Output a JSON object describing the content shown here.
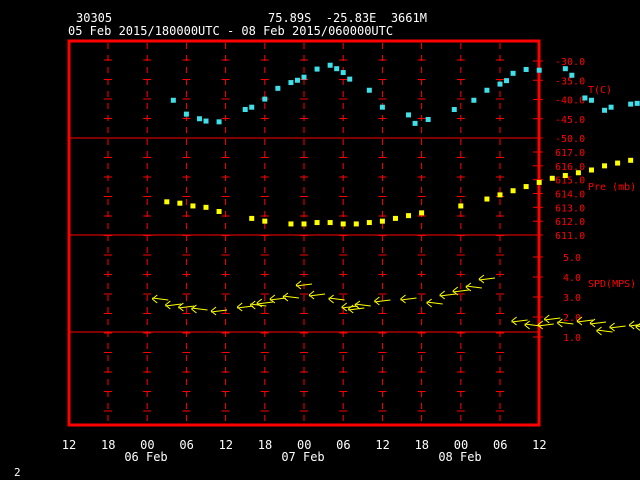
{
  "header": {
    "station_id": "30305",
    "location": "75.89S  -25.83E  3661M",
    "time_range": "05 Feb 2015/180000UTC - 08 Feb 2015/060000UTC"
  },
  "page_number": "2",
  "colors": {
    "frame": "#ff0000",
    "temperature": "#40e0e8",
    "pressure": "#ffff00",
    "wind": "#ffff00",
    "axis_text": "#ffffff",
    "right_labels": "#ff0000"
  },
  "chart_data": [
    {
      "type": "scatter",
      "title": "T(C)",
      "x_unit": "hours since 06 Feb 00UTC",
      "ylim": [
        -50,
        -30
      ],
      "yticks": [
        "-30.0",
        "-35.0",
        "-40.0",
        "-45.0",
        "-50.0"
      ],
      "x": [
        -8,
        -6,
        -4,
        -3,
        -1,
        3,
        4,
        6,
        8,
        10,
        11,
        12,
        14,
        16,
        17,
        18,
        19,
        22,
        24,
        28,
        29,
        31,
        35,
        38,
        40,
        42,
        43,
        44,
        46,
        48,
        52,
        53,
        55,
        56,
        58,
        59,
        62,
        63,
        64
      ],
      "values": [
        -40.2,
        -43.8,
        -45.0,
        -45.6,
        -45.8,
        -42.6,
        -42.0,
        -39.9,
        -37.1,
        -35.6,
        -35.0,
        -34.2,
        -32.1,
        -31.1,
        -32.0,
        -33.0,
        -34.7,
        -37.6,
        -42.0,
        -44.0,
        -46.2,
        -45.2,
        -42.6,
        -40.2,
        -37.6,
        -36.0,
        -35.1,
        -33.2,
        -32.2,
        -32.4,
        -32.0,
        -33.7,
        -39.6,
        -40.2,
        -42.8,
        -42.0,
        -41.2,
        -41.0,
        -38.4,
        -39.0
      ]
    },
    {
      "type": "scatter",
      "title": "Pre (mb)",
      "x_unit": "hours since 06 Feb 00UTC",
      "ylim": [
        611,
        617
      ],
      "yticks": [
        "617.0",
        "616.0",
        "615.0",
        "614.0",
        "613.0",
        "612.0",
        "611.0"
      ],
      "x": [
        -9,
        -7,
        -5,
        -3,
        -1,
        4,
        6,
        10,
        12,
        14,
        16,
        18,
        20,
        22,
        24,
        26,
        28,
        30,
        36,
        40,
        42,
        44,
        46,
        48,
        50,
        52,
        54,
        56,
        58,
        60,
        62,
        64,
        66,
        70,
        72
      ],
      "values": [
        613.4,
        613.3,
        613.1,
        613.0,
        612.7,
        612.2,
        612.0,
        611.8,
        611.8,
        611.9,
        611.9,
        611.8,
        611.8,
        611.9,
        612.0,
        612.2,
        612.4,
        612.6,
        613.1,
        613.6,
        613.9,
        614.2,
        614.5,
        614.8,
        615.1,
        615.3,
        615.5,
        615.7,
        616.0,
        616.2,
        616.4,
        616.6,
        616.7,
        616.6,
        616.7
      ]
    },
    {
      "type": "scatter",
      "title": "SPD(MPS)",
      "x_unit": "hours since 06 Feb 00UTC",
      "ylim": [
        0,
        6
      ],
      "yticks": [
        "5.0",
        "4.0",
        "3.0",
        "2.0",
        "1.0"
      ],
      "x": [
        -10,
        -8,
        -6,
        -4,
        -1,
        3,
        5,
        6,
        8,
        10,
        12,
        14,
        17,
        19,
        20,
        21,
        24,
        28,
        32,
        34,
        36,
        38,
        40,
        45,
        47,
        49,
        50,
        52,
        55,
        57,
        58,
        60,
        63,
        64,
        66,
        68,
        72
      ],
      "values": [
        2.9,
        2.6,
        2.5,
        2.4,
        2.3,
        2.5,
        2.6,
        2.7,
        2.9,
        3.0,
        3.6,
        3.1,
        2.9,
        2.5,
        2.4,
        2.6,
        2.8,
        2.9,
        2.7,
        3.1,
        3.3,
        3.5,
        3.9,
        1.8,
        1.6,
        1.6,
        1.9,
        1.7,
        1.8,
        1.7,
        1.3,
        1.5,
        1.6,
        1.5,
        1.6,
        2.5,
        2.3
      ]
    }
  ],
  "x_axis": {
    "tick_labels": [
      "12",
      "18",
      "00",
      "06",
      "12",
      "18",
      "00",
      "06",
      "12",
      "18",
      "00",
      "06",
      "12"
    ],
    "date_labels": [
      "06 Feb",
      "07 Feb",
      "08 Feb"
    ]
  }
}
